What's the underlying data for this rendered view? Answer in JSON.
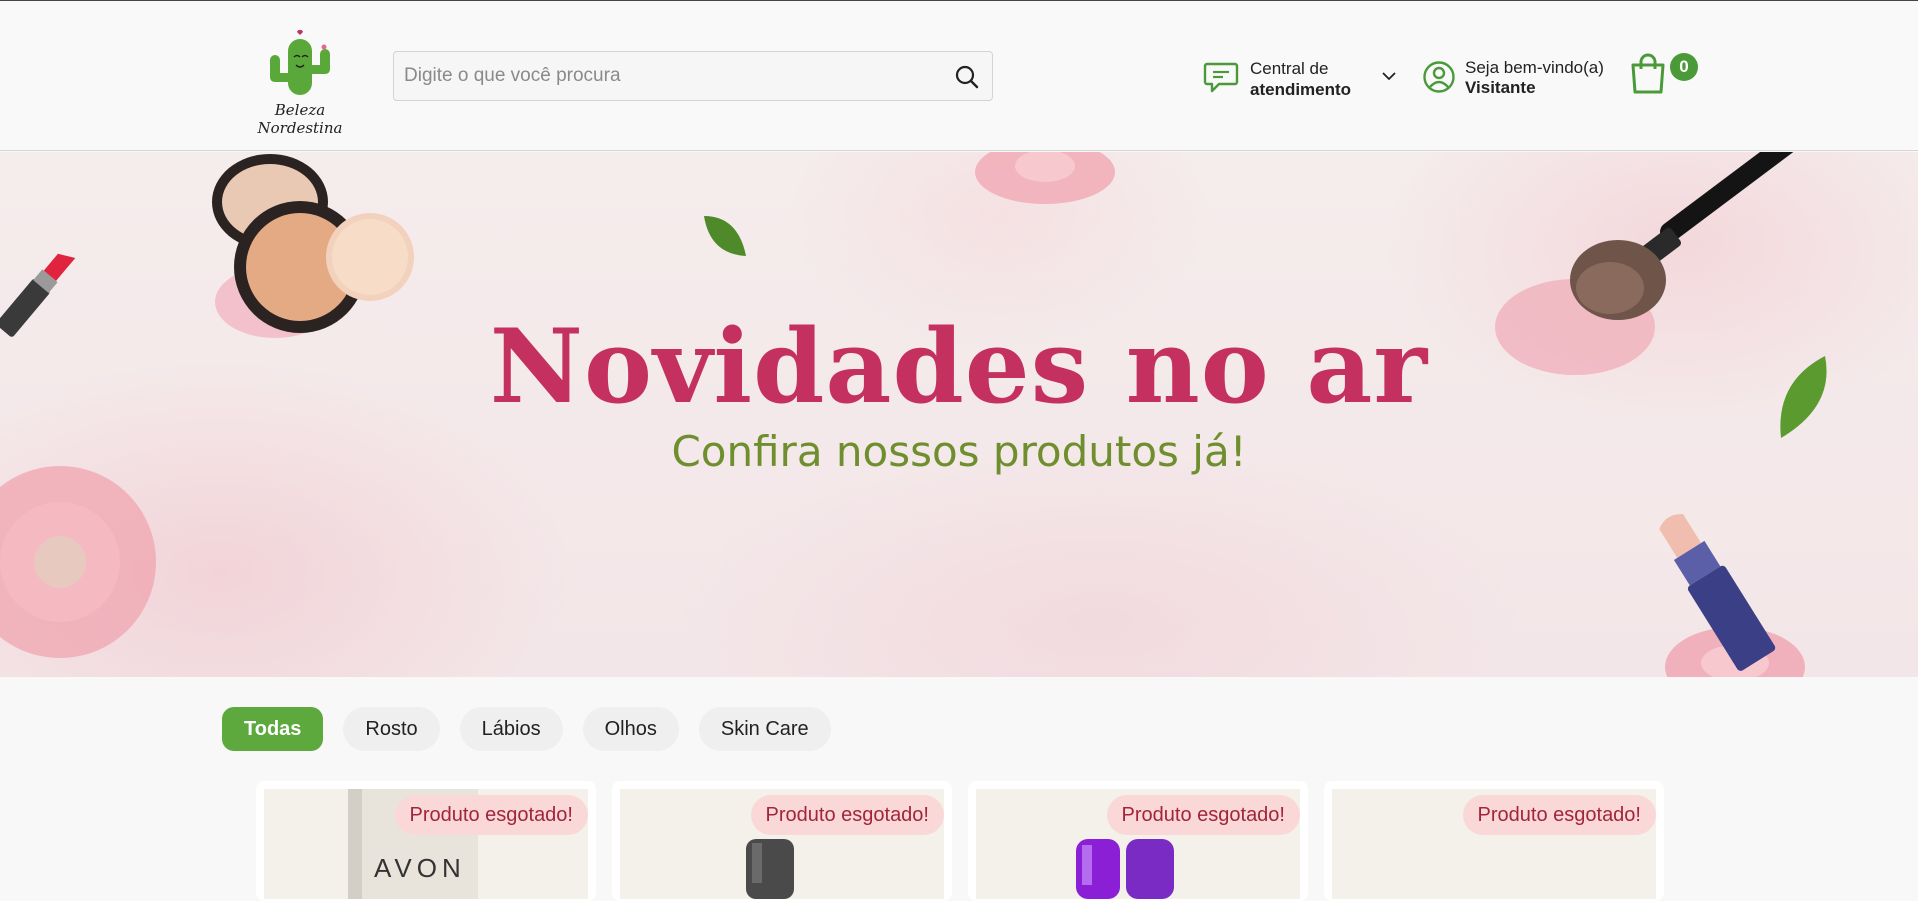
{
  "header": {
    "logo_text": "Beleza Nordestina",
    "search_placeholder": "Digite o que você procura",
    "support_line1": "Central de",
    "support_line2": "atendimento",
    "welcome_line1": "Seja bem-vindo(a)",
    "welcome_line2": "Visitante",
    "cart_count": "0"
  },
  "hero": {
    "title": "Novidades no ar",
    "subtitle": "Confira nossos produtos já!"
  },
  "filters": [
    {
      "label": "Todas",
      "active": true
    },
    {
      "label": "Rosto",
      "active": false
    },
    {
      "label": "Lábios",
      "active": false
    },
    {
      "label": "Olhos",
      "active": false
    },
    {
      "label": "Skin Care",
      "active": false
    }
  ],
  "products": [
    {
      "badge": "Produto esgotado!",
      "brand": "AVON"
    },
    {
      "badge": "Produto esgotado!"
    },
    {
      "badge": "Produto esgotado!"
    },
    {
      "badge": "Produto esgotado!"
    }
  ],
  "colors": {
    "accent_green": "#5da93e",
    "hero_title": "#c4305f",
    "hero_subtitle": "#6f8f2f",
    "badge_bg": "#fbd8d8",
    "badge_text": "#a0263b"
  }
}
